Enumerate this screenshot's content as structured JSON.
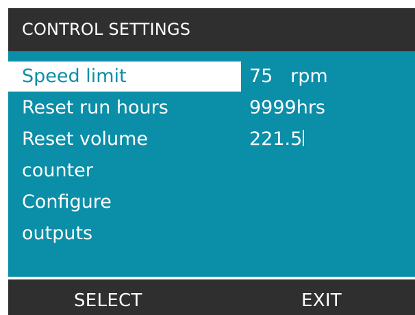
{
  "title": "CONTROL SETTINGS",
  "menu": {
    "items": [
      {
        "label": "Speed limit",
        "value": "75   rpm",
        "selected": true
      },
      {
        "label": "Reset run hours",
        "value": "9999hrs",
        "selected": false
      },
      {
        "label": "Reset volume",
        "value": "221.5",
        "selected": false
      },
      {
        "label": "counter",
        "value": "",
        "selected": false
      },
      {
        "label": "Configure",
        "value": "",
        "selected": false
      },
      {
        "label": "outputs",
        "value": "",
        "selected": false
      }
    ]
  },
  "softkeys": {
    "left": "SELECT",
    "right": "EXIT"
  },
  "colors": {
    "screen_background": "#0b8ea7",
    "bar_background": "#2f2f2f",
    "highlight": "#ffffff",
    "text": "#ffffff"
  }
}
